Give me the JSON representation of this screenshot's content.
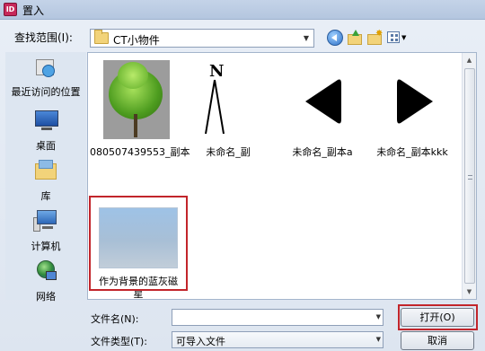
{
  "window": {
    "title": "置入",
    "app_icon_text": "ID"
  },
  "toolbar": {
    "look_in_label": "查找范围(I):",
    "look_in_value": "CT小物件",
    "icons": [
      "back-icon",
      "up-folder-icon",
      "new-folder-icon",
      "views-menu-icon"
    ]
  },
  "places": [
    {
      "label": "最近访问的位置",
      "icon": "recent-places-icon"
    },
    {
      "label": "桌面",
      "icon": "desktop-icon"
    },
    {
      "label": "库",
      "icon": "libraries-icon"
    },
    {
      "label": "计算机",
      "icon": "computer-icon"
    },
    {
      "label": "网络",
      "icon": "network-icon"
    }
  ],
  "files": [
    {
      "name": "080507439553_副本",
      "thumb": "tree"
    },
    {
      "name": "未命名_副",
      "thumb": "north-arrow"
    },
    {
      "name": "未命名_副本a",
      "thumb": "left-arrow"
    },
    {
      "name": "未命名_副本kkk",
      "thumb": "right-arrow"
    },
    {
      "name": "作为背景的蓝灰磁星",
      "thumb": "blue-gray-gradient",
      "selected": true
    }
  ],
  "form": {
    "filename_label": "文件名(N):",
    "filename_value": "",
    "filetype_label": "文件类型(T):",
    "filetype_value": "可导入文件"
  },
  "buttons": {
    "open": "打开(O)",
    "cancel": "取消"
  },
  "colors": {
    "highlight": "#c2252b",
    "app_icon": "#c6285a"
  }
}
